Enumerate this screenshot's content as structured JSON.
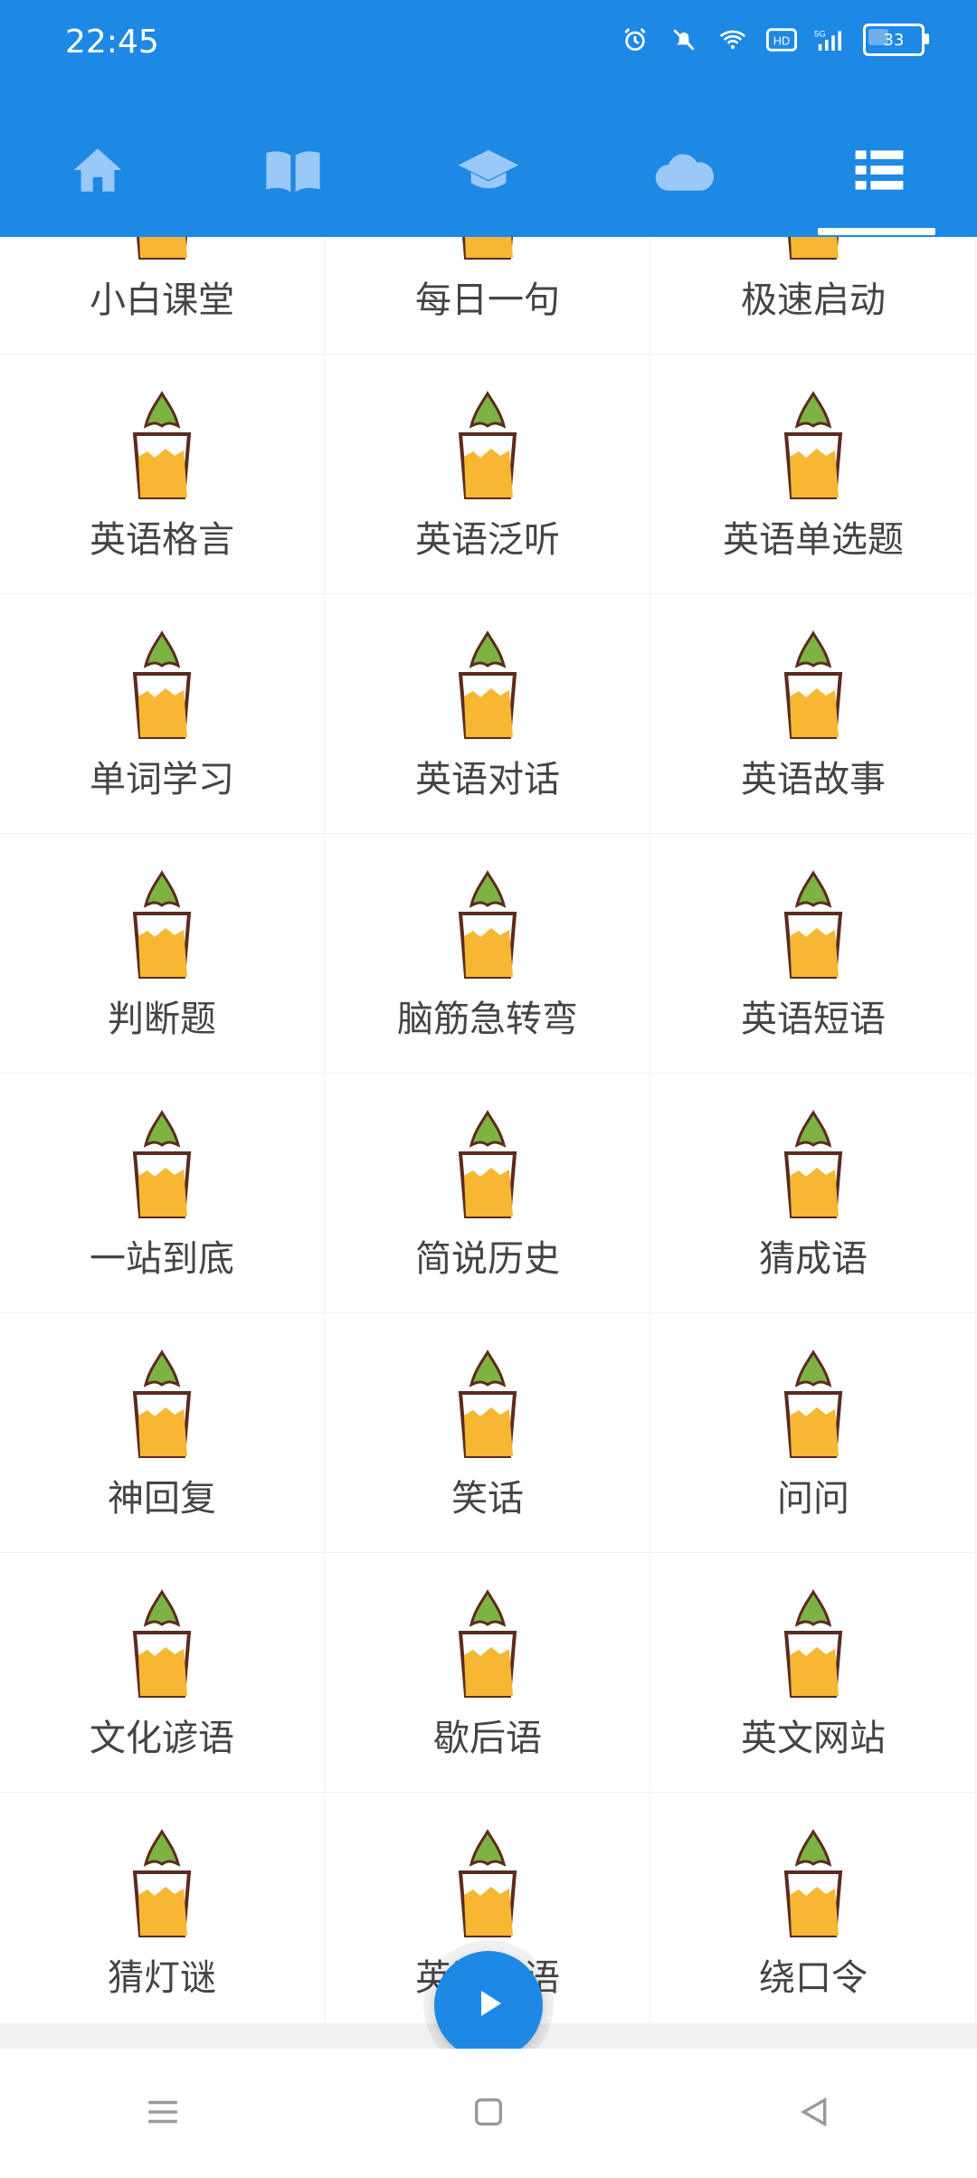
{
  "status_bar": {
    "time": "22:45",
    "battery": "33"
  },
  "top_tabs": [
    {
      "icon": "home-icon"
    },
    {
      "icon": "book-icon"
    },
    {
      "icon": "graduation-cap-icon"
    },
    {
      "icon": "cloud-icon"
    },
    {
      "icon": "list-icon",
      "active": true
    }
  ],
  "grid": {
    "items": [
      {
        "label": "小白课堂"
      },
      {
        "label": "每日一句"
      },
      {
        "label": "极速启动"
      },
      {
        "label": "英语格言"
      },
      {
        "label": "英语泛听"
      },
      {
        "label": "英语单选题"
      },
      {
        "label": "单词学习"
      },
      {
        "label": "英语对话"
      },
      {
        "label": "英语故事"
      },
      {
        "label": "判断题"
      },
      {
        "label": "脑筋急转弯"
      },
      {
        "label": "英语短语"
      },
      {
        "label": "一站到底"
      },
      {
        "label": "简说历史"
      },
      {
        "label": "猜成语"
      },
      {
        "label": "神回复"
      },
      {
        "label": "笑话"
      },
      {
        "label": "问问"
      },
      {
        "label": "文化谚语"
      },
      {
        "label": "歇后语"
      },
      {
        "label": "英文网站"
      },
      {
        "label": "猜灯谜"
      },
      {
        "label": "英语俗语"
      },
      {
        "label": "绕口令"
      }
    ]
  },
  "fab": {
    "icon": "play-icon"
  },
  "system_nav": [
    {
      "icon": "menu-icon"
    },
    {
      "icon": "home-square-icon"
    },
    {
      "icon": "back-icon"
    }
  ],
  "colors": {
    "primary": "#1E88E5",
    "pot": "#F7B733",
    "plant": "#7CB342"
  }
}
